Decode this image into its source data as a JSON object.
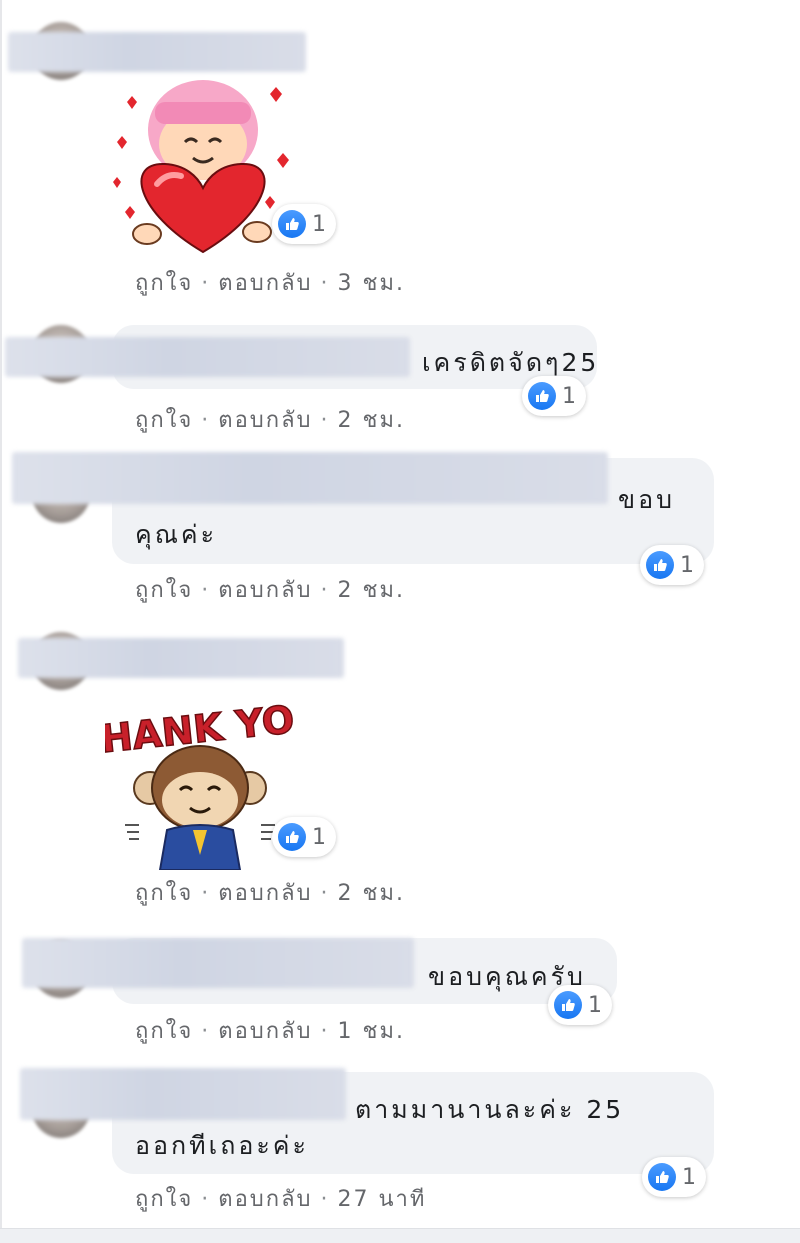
{
  "labels": {
    "like": "ถูกใจ",
    "reply": "ตอบกลับ",
    "sep": "·"
  },
  "brand": {
    "like_blue": "#1877f2",
    "bubble_bg": "#f0f2f5"
  },
  "comments": [
    {
      "text_lines": [],
      "sticker": "heart-girl-sticker",
      "reaction_count": "1",
      "time": "3 ชม."
    },
    {
      "text_lines": [
        "เครดิตจัดๆ25"
      ],
      "reaction_count": "1",
      "time": "2 ชม."
    },
    {
      "text_lines": [
        "ขอบ",
        "คุณค่ะ"
      ],
      "reaction_count": "1",
      "time": "2 ชม."
    },
    {
      "text_lines": [],
      "sticker": "thank-you-monkey-sticker",
      "sticker_text": "THANK YOU",
      "reaction_count": "1",
      "time": "2 ชม."
    },
    {
      "text_lines": [
        "ขอบคุณครับ"
      ],
      "reaction_count": "1",
      "time": "1 ชม."
    },
    {
      "text_lines": [
        "ตามมานานละค่ะ 25",
        "ออกทีเถอะค่ะ"
      ],
      "reaction_count": "1",
      "time": "27 นาที"
    }
  ]
}
